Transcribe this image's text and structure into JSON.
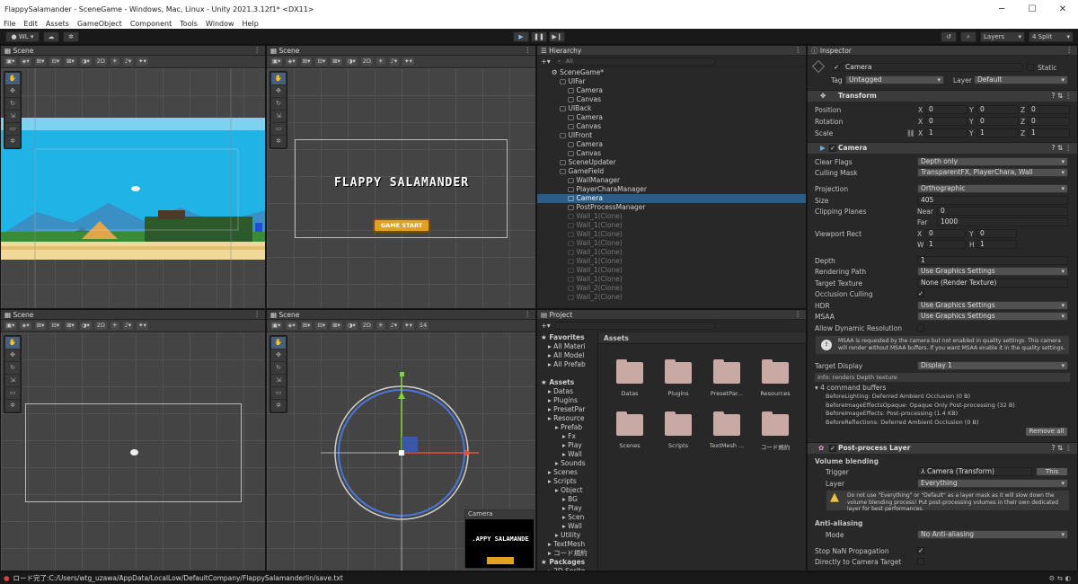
{
  "window": {
    "title": "FlappySalamander - SceneGame - Windows, Mac, Linux - Unity 2021.3.12f1* <DX11>",
    "min": "─",
    "max": "☐",
    "close": "✕"
  },
  "menu": [
    "File",
    "Edit",
    "Assets",
    "GameObject",
    "Component",
    "Tools",
    "Window",
    "Help"
  ],
  "toolbar": {
    "account": "WL",
    "layers": "Layers",
    "layout": "4 Split"
  },
  "scene": {
    "tab": "Scene",
    "mode2d": "2D",
    "hidden_count": "14"
  },
  "game_title": "FLAPPY SALAMANDER",
  "game_start": "GAME START",
  "camera_preview": {
    "title": "Camera",
    "text": ".APPY SALAMANDE"
  },
  "hierarchy": {
    "tab": "Hierarchy",
    "search_placeholder": "All",
    "items": [
      {
        "label": "SceneGame*",
        "indent": 0
      },
      {
        "label": "UIFar",
        "indent": 1
      },
      {
        "label": "Camera",
        "indent": 2
      },
      {
        "label": "Canvas",
        "indent": 2
      },
      {
        "label": "UIBack",
        "indent": 1
      },
      {
        "label": "Camera",
        "indent": 2
      },
      {
        "label": "Canvas",
        "indent": 2
      },
      {
        "label": "UIFront",
        "indent": 1
      },
      {
        "label": "Camera",
        "indent": 2
      },
      {
        "label": "Canvas",
        "indent": 2
      },
      {
        "label": "SceneUpdater",
        "indent": 1
      },
      {
        "label": "GameField",
        "indent": 1
      },
      {
        "label": "WallManager",
        "indent": 2
      },
      {
        "label": "PlayerCharaManager",
        "indent": 2
      },
      {
        "label": "Camera",
        "indent": 2,
        "selected": true
      },
      {
        "label": "PostProcessManager",
        "indent": 2
      },
      {
        "label": "Wall_1(Clone)",
        "indent": 2,
        "dim": true
      },
      {
        "label": "Wall_1(Clone)",
        "indent": 2,
        "dim": true
      },
      {
        "label": "Wall_1(Clone)",
        "indent": 2,
        "dim": true
      },
      {
        "label": "Wall_1(Clone)",
        "indent": 2,
        "dim": true
      },
      {
        "label": "Wall_1(Clone)",
        "indent": 2,
        "dim": true
      },
      {
        "label": "Wall_1(Clone)",
        "indent": 2,
        "dim": true
      },
      {
        "label": "Wall_1(Clone)",
        "indent": 2,
        "dim": true
      },
      {
        "label": "Wall_1(Clone)",
        "indent": 2,
        "dim": true
      },
      {
        "label": "Wall_2(Clone)",
        "indent": 2,
        "dim": true
      },
      {
        "label": "Wall_2(Clone)",
        "indent": 2,
        "dim": true
      }
    ]
  },
  "project": {
    "tab": "Project",
    "tree": [
      {
        "label": "Favorites",
        "indent": 0,
        "bold": true
      },
      {
        "label": "All Materi",
        "indent": 1
      },
      {
        "label": "All Model",
        "indent": 1
      },
      {
        "label": "All Prefab",
        "indent": 1
      },
      {
        "label": "",
        "indent": 0
      },
      {
        "label": "Assets",
        "indent": 0,
        "bold": true
      },
      {
        "label": "Datas",
        "indent": 1
      },
      {
        "label": "Plugins",
        "indent": 1
      },
      {
        "label": "PresetPar",
        "indent": 1
      },
      {
        "label": "Resource",
        "indent": 1
      },
      {
        "label": "Prefab",
        "indent": 2
      },
      {
        "label": "Fx",
        "indent": 3
      },
      {
        "label": "Play",
        "indent": 3
      },
      {
        "label": "Wall",
        "indent": 3
      },
      {
        "label": "Sounds",
        "indent": 2
      },
      {
        "label": "Scenes",
        "indent": 1
      },
      {
        "label": "Scripts",
        "indent": 1
      },
      {
        "label": "Object",
        "indent": 2
      },
      {
        "label": "BG",
        "indent": 3
      },
      {
        "label": "Play",
        "indent": 3
      },
      {
        "label": "Scen",
        "indent": 3
      },
      {
        "label": "Wall",
        "indent": 3
      },
      {
        "label": "Utility",
        "indent": 2
      },
      {
        "label": "TextMesh",
        "indent": 1
      },
      {
        "label": "コード規約",
        "indent": 1
      },
      {
        "label": "Packages",
        "indent": 0,
        "bold": true
      },
      {
        "label": "2D Sprite",
        "indent": 1
      }
    ],
    "breadcrumb": "Assets",
    "folders": [
      "Datas",
      "Plugins",
      "PresetPar...",
      "Resources",
      "Scenes",
      "Scripts",
      "TextMesh ...",
      "コード規約"
    ]
  },
  "inspector": {
    "tab": "Inspector",
    "name": "Camera",
    "static": "Static",
    "tag_label": "Tag",
    "tag": "Untagged",
    "layer_label": "Layer",
    "layer": "Default",
    "transform": {
      "title": "Transform",
      "position": {
        "label": "Position",
        "x": "0",
        "y": "0",
        "z": "0"
      },
      "rotation": {
        "label": "Rotation",
        "x": "0",
        "y": "0",
        "z": "0"
      },
      "scale": {
        "label": "Scale",
        "x": "1",
        "y": "1",
        "z": "1"
      }
    },
    "camera": {
      "title": "Camera",
      "clear_flags": {
        "label": "Clear Flags",
        "value": "Depth only"
      },
      "culling_mask": {
        "label": "Culling Mask",
        "value": "TransparentFX, PlayerChara, Wall"
      },
      "projection": {
        "label": "Projection",
        "value": "Orthographic"
      },
      "size": {
        "label": "Size",
        "value": "405"
      },
      "clipping": {
        "label": "Clipping Planes",
        "near_label": "Near",
        "near": "0",
        "far_label": "Far",
        "far": "1000"
      },
      "viewport": {
        "label": "Viewport Rect",
        "x": "0",
        "y": "0",
        "w": "1",
        "h": "1"
      },
      "depth": {
        "label": "Depth",
        "value": "1"
      },
      "rendering_path": {
        "label": "Rendering Path",
        "value": "Use Graphics Settings"
      },
      "target_texture": {
        "label": "Target Texture",
        "value": "None (Render Texture)"
      },
      "occlusion": {
        "label": "Occlusion Culling"
      },
      "hdr": {
        "label": "HDR",
        "value": "Use Graphics Settings"
      },
      "msaa": {
        "label": "MSAA",
        "value": "Use Graphics Settings"
      },
      "dynamic_res": {
        "label": "Allow Dynamic Resolution"
      },
      "msaa_warning": "MSAA is requested by the camera but not enabled in quality settings. This camera will render without MSAA buffers. If you want MSAA enable it in the quality settings.",
      "target_display": {
        "label": "Target Display",
        "value": "Display 1"
      },
      "info": "Info: renders Depth texture",
      "cmd_buffers": "4 command buffers",
      "buffers": [
        "BeforeLighting: Deferred Ambient Occlusion (0 B)",
        "BeforeImageEffectsOpaque: Opaque Only Post-processing (32 B)",
        "BeforeImageEffects: Post-processing (1.4 KB)",
        "BeforeReflections: Deferred Ambient Occlusion (0 B)"
      ],
      "remove_all": "Remove all"
    },
    "post": {
      "title": "Post-process Layer",
      "volume_blending": "Volume blending",
      "trigger_label": "Trigger",
      "trigger": "Camera (Transform)",
      "this": "This",
      "layer_label": "Layer",
      "layer": "Everything",
      "warning": "Do not use \"Everything\" or \"Default\" as a layer mask as it will slow down the volume blending process! Put post-processing volumes in their own dedicated layer for best performances.",
      "aa": "Anti-aliasing",
      "mode_label": "Mode",
      "mode": "No Anti-aliasing",
      "nan_label": "Stop NaN Propagation",
      "direct_label": "Directly to Camera Target"
    }
  },
  "status": "ロード完了:C:/Users/wtg_uzawa/AppData/LocalLow/DefaultCompany/FlappySalamanderlin/save.txt",
  "colors": {
    "sky": "#1fb3e6",
    "selection": "#2c5d87",
    "accent_gold": "#e0a020",
    "circle": "#4a76d8"
  }
}
